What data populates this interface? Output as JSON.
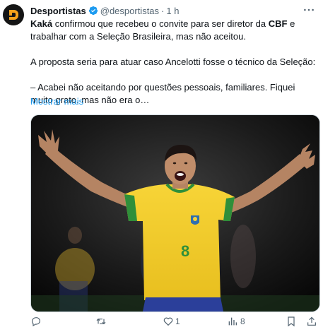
{
  "tweet": {
    "author_name": "Desportistas",
    "author_handle": "@desportistas",
    "separator": "·",
    "time": "1 h",
    "text_p1_name": "Kaká",
    "text_p1_mid": " confirmou que recebeu o convite para ser diretor da ",
    "text_p1_org": "CBF",
    "text_p1_end": " e trabalhar com a Seleção Brasileira, mas não aceitou.",
    "text_p2": "A proposta seria para atuar caso Ancelotti fosse o técnico da Seleção:",
    "text_p3": "– Acabei não aceitando por questões pessoais, familiares. Fiquei muito grato, mas não era o…",
    "show_more": "Mostrar mais",
    "media": {
      "kind": "photo",
      "jersey_number": "8"
    },
    "actions": {
      "reply_count": "",
      "retweet_count": "",
      "like_count": "1",
      "views_count": "8"
    }
  },
  "colors": {
    "link": "#1d9bf0",
    "secondary_text": "#536471",
    "verified": "#1d9bf0",
    "jersey_yellow": "#f6d02b",
    "shorts_blue": "#2b3f9a"
  },
  "icons": [
    "avatar-logo-icon",
    "verified-badge-icon",
    "more-options-icon",
    "reply-icon",
    "retweet-icon",
    "like-icon",
    "views-icon",
    "bookmark-icon",
    "share-icon"
  ]
}
